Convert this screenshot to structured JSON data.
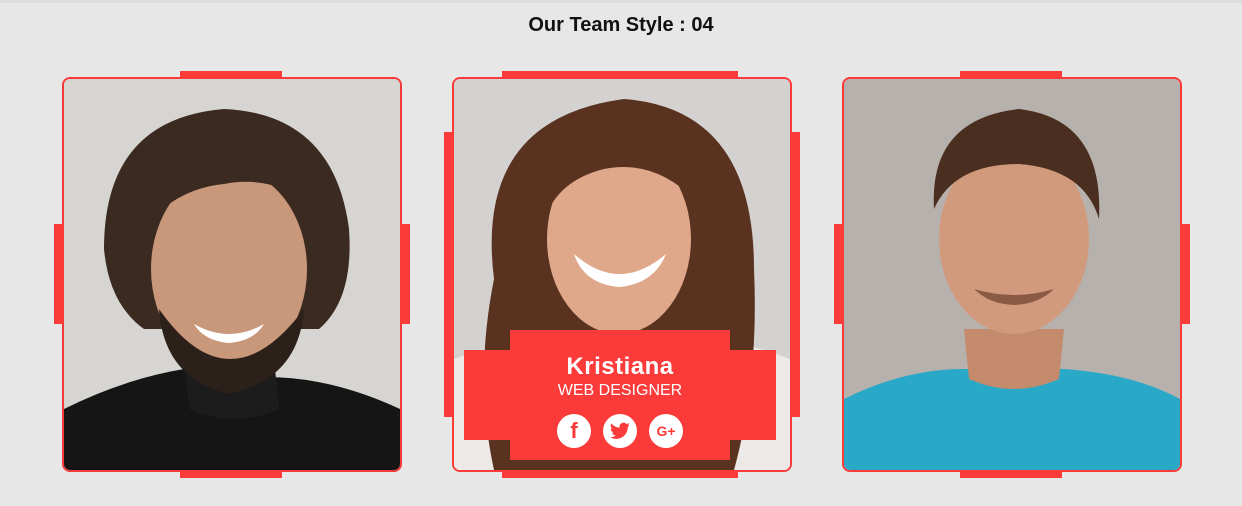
{
  "page": {
    "title": "Our Team Style : 04"
  },
  "colors": {
    "accent": "#fb3a3a",
    "background": "#e7e7e7"
  },
  "members": [
    {
      "photo": "man-with-long-hair-black-turtleneck-photo"
    },
    {
      "photo": "smiling-woman-with-curly-hair-photo",
      "name": "Kristiana",
      "role": "WEB DESIGNER",
      "socials": [
        {
          "icon": "facebook-icon",
          "glyph": "f"
        },
        {
          "icon": "twitter-icon"
        },
        {
          "icon": "google-plus-icon",
          "glyph": "G+"
        }
      ]
    },
    {
      "photo": "man-in-blue-tshirt-photo"
    }
  ]
}
